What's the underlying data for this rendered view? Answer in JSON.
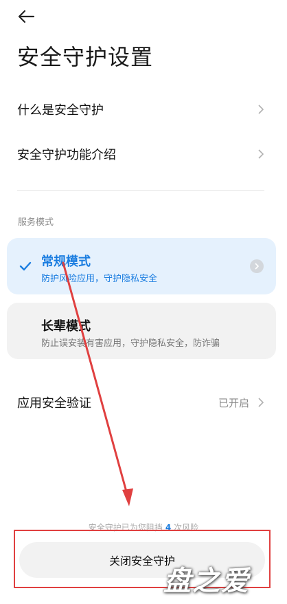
{
  "header": {
    "title": "安全守护设置"
  },
  "menu": [
    {
      "label": "什么是安全守护"
    },
    {
      "label": "安全守护功能介绍"
    }
  ],
  "service_mode": {
    "section_label": "服务模式",
    "modes": [
      {
        "name": "常规模式",
        "desc": "防护风险应用，守护隐私安全",
        "selected": true
      },
      {
        "name": "长辈模式",
        "desc": "防止误安装有害应用，守护隐私安全，防诈骗",
        "selected": false
      }
    ]
  },
  "app_verify": {
    "label": "应用安全验证",
    "value": "已开启"
  },
  "footer": {
    "blocked_prefix": "安全守护已为您阻挡",
    "blocked_count": "4",
    "blocked_suffix": "次风险",
    "close_button": "关闭安全守护"
  },
  "watermark": "盘之爱",
  "colors": {
    "accent": "#1a7de0",
    "annotation": "#e04040",
    "active_card": "#e5f1fd"
  }
}
